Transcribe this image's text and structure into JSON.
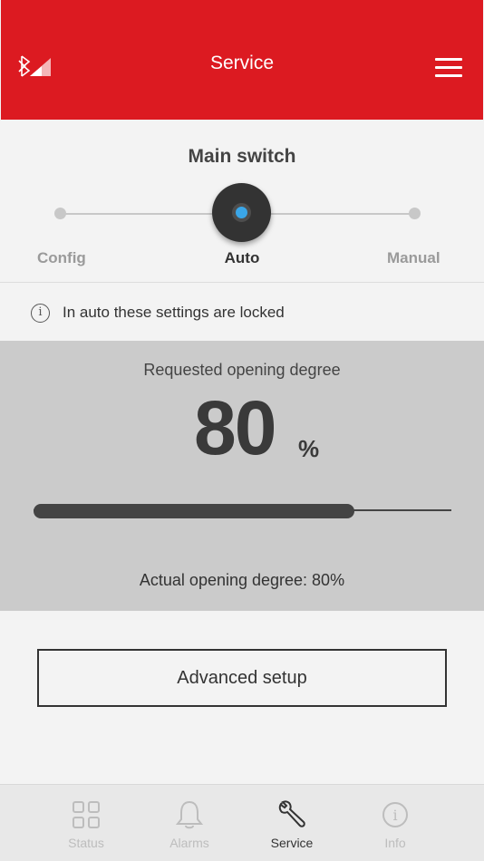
{
  "header": {
    "title": "Service",
    "bluetooth_icon": "bluetooth-signal-icon",
    "menu_icon": "hamburger-menu-icon",
    "brand_color": "#dc1a21"
  },
  "main_switch": {
    "title": "Main switch",
    "positions": [
      "Config",
      "Auto",
      "Manual"
    ],
    "selected": "Auto",
    "knob_color": "#3aa6e8"
  },
  "locked_info": {
    "icon": "info-icon",
    "text": "In auto these settings are locked"
  },
  "opening": {
    "requested_label": "Requested opening degree",
    "requested_value": "80",
    "unit": "%",
    "slider_fraction": 0.8,
    "actual_label": "Actual opening degree: 80%"
  },
  "advanced_setup": {
    "label": "Advanced setup"
  },
  "bottom_nav": {
    "items": [
      {
        "label": "Status",
        "icon": "grid-icon",
        "active": false
      },
      {
        "label": "Alarms",
        "icon": "bell-icon",
        "active": false
      },
      {
        "label": "Service",
        "icon": "wrench-icon",
        "active": true
      },
      {
        "label": "Info",
        "icon": "info-icon",
        "active": false
      }
    ]
  }
}
